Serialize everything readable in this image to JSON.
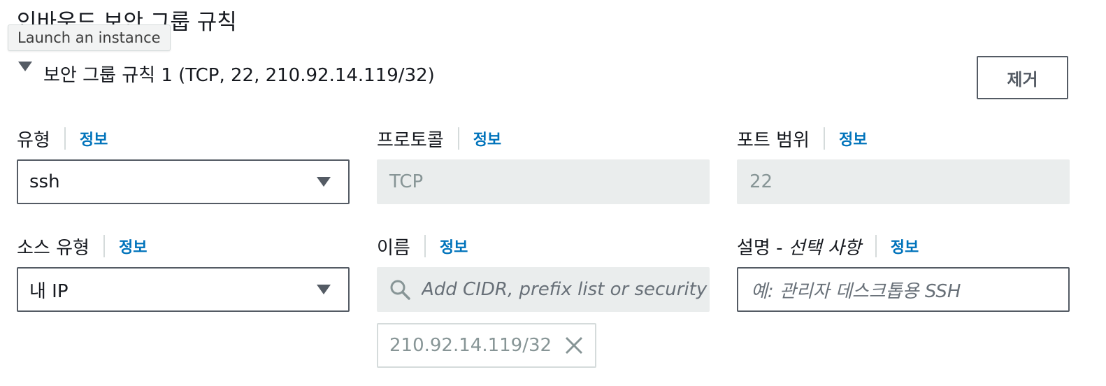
{
  "section": {
    "title": "인바운드 보안 그룹 규칙",
    "tooltip": "Launch an instance"
  },
  "rule": {
    "title": "보안 그룹 규칙 1 (TCP, 22, 210.92.14.119/32)",
    "remove_label": "제거"
  },
  "info_label": "정보",
  "fields": {
    "type": {
      "label": "유형",
      "value": "ssh"
    },
    "protocol": {
      "label": "프로토콜",
      "value": "TCP"
    },
    "port_range": {
      "label": "포트 범위",
      "value": "22"
    },
    "source_type": {
      "label": "소스 유형",
      "value": "내 IP"
    },
    "name": {
      "label": "이름",
      "placeholder": "Add CIDR, prefix list or security g"
    },
    "description": {
      "label": "설명 - ",
      "label_optional": "선택 사항",
      "placeholder": "예: 관리자 데스크톱용 SSH"
    }
  },
  "tokens": [
    {
      "value": "210.92.14.119/32"
    }
  ],
  "icons": {
    "expand": "caret-down-icon",
    "dropdown": "triangle-down-icon",
    "search": "search-icon",
    "remove": "close-icon"
  },
  "colors": {
    "link": "#0073bb",
    "text": "#16191f",
    "disabled_bg": "#eaeded",
    "disabled_text": "#879596",
    "border": "#545b64"
  }
}
